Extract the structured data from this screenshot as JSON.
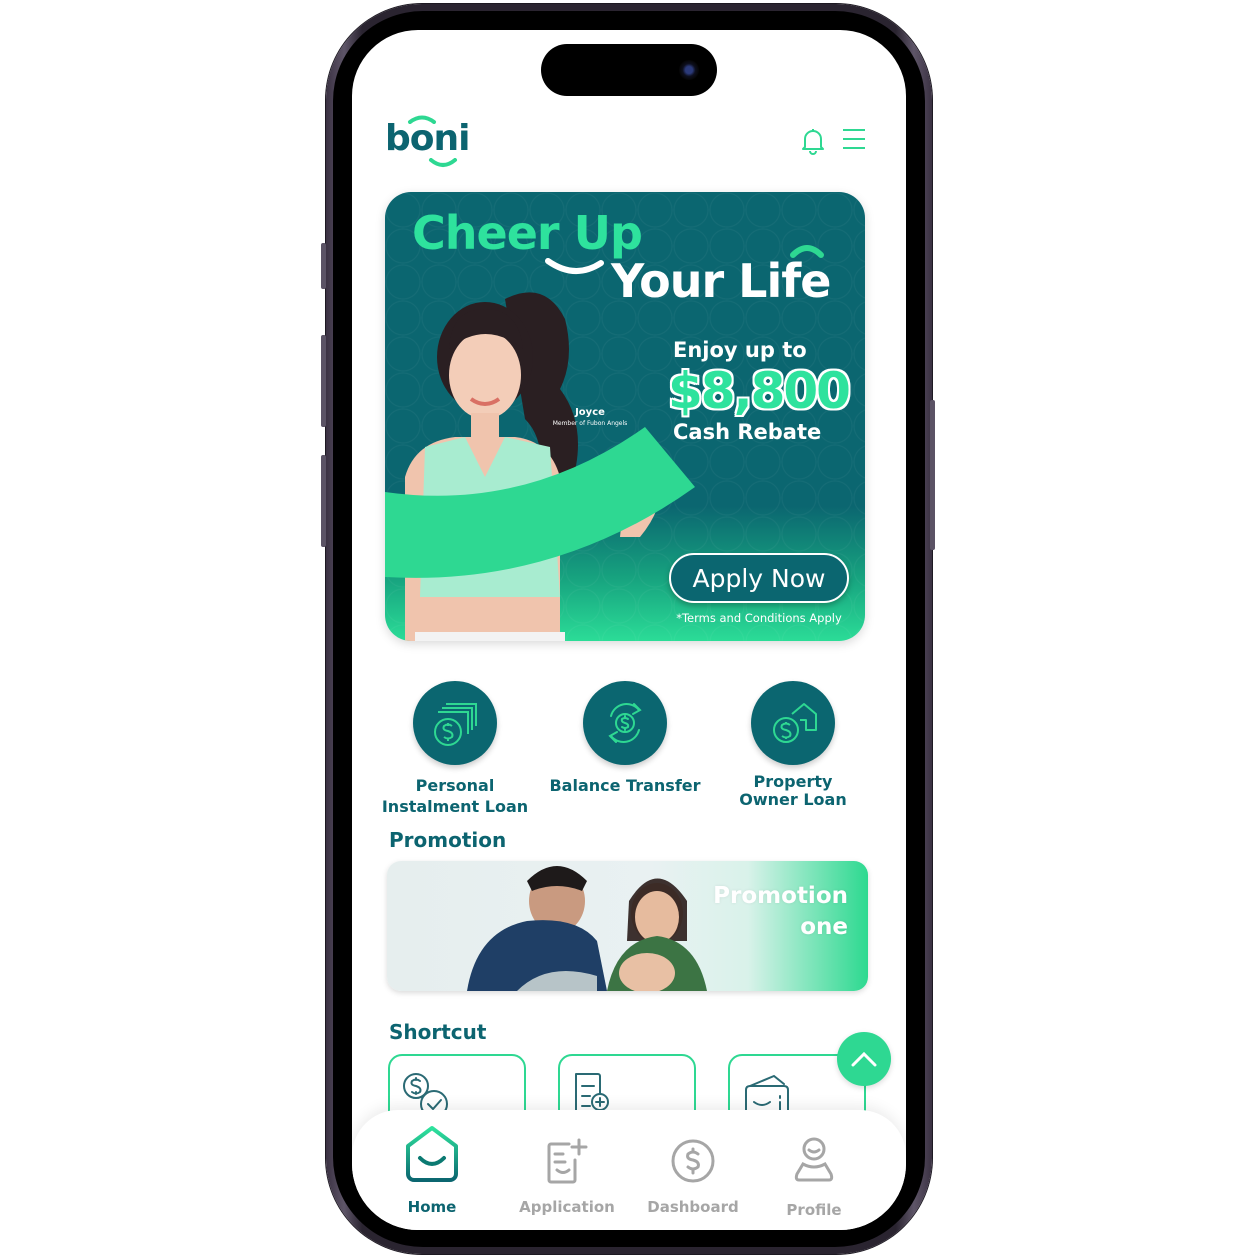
{
  "app": {
    "logo": "boni"
  },
  "header": {
    "notification_icon": "bell-icon",
    "menu_icon": "hamburger-menu-icon"
  },
  "hero": {
    "title_line1": "Cheer Up",
    "title_line2": "Your Life",
    "enjoy": "Enjoy up to",
    "amount": "$8,800",
    "rebate": "Cash Rebate",
    "person_name": "Joyce",
    "person_caption": "Member of Fubon Angels",
    "cta": "Apply Now",
    "terms": "*Terms and Conditions Apply"
  },
  "products": [
    {
      "label_line1": "Personal",
      "label_line2": "Instalment Loan",
      "icon": "cash-stack-icon"
    },
    {
      "label_line1": "Balance Transfer",
      "label_line2": "",
      "icon": "dollar-transfer-icon"
    },
    {
      "label_line1": "Property",
      "label_line2": "Owner Loan",
      "icon": "dollar-house-icon"
    }
  ],
  "promotion": {
    "title": "Promotion",
    "banner_text_line1": "Promotion",
    "banner_text_line2": "one"
  },
  "shortcut": {
    "title": "Shortcut",
    "items": [
      {
        "icon": "dollar-check-icon"
      },
      {
        "icon": "document-add-icon"
      },
      {
        "icon": "wallet-icon"
      }
    ]
  },
  "bottom_nav": {
    "items": [
      {
        "label": "Home",
        "icon": "home-icon",
        "active": true
      },
      {
        "label": "Application",
        "icon": "application-icon",
        "active": false
      },
      {
        "label": "Dashboard",
        "icon": "dollar-circle-icon",
        "active": false
      },
      {
        "label": "Profile",
        "icon": "profile-icon",
        "active": false
      }
    ]
  },
  "colors": {
    "brand_dark": "#0b6670",
    "brand_green": "#2ed892",
    "inactive": "#a6a6a6"
  }
}
